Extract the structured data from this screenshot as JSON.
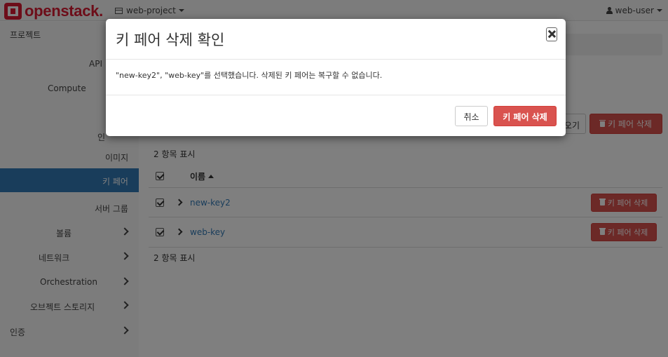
{
  "navbar": {
    "logo_text": "openstack.",
    "project": "web-project",
    "user": "web-user"
  },
  "sidebar": {
    "items": [
      {
        "label": "프로젝트"
      },
      {
        "label": "API"
      },
      {
        "label": "Compute"
      },
      {
        "label": "인"
      },
      {
        "label": "이미지"
      },
      {
        "label": "키 페어",
        "active": true
      },
      {
        "label": "서버 그룹"
      },
      {
        "label": "볼륨"
      },
      {
        "label": "네트워크"
      },
      {
        "label": "Orchestration"
      },
      {
        "label": "오브젝트 스토리지"
      },
      {
        "label": "인증"
      }
    ]
  },
  "main": {
    "import_button_partial": "오기",
    "delete_button": "키 페어 삭제",
    "count_text": "2 항목 표시",
    "table": {
      "header_name": "이름",
      "rows": [
        {
          "name": "new-key2",
          "action": "키 페어 삭제"
        },
        {
          "name": "web-key",
          "action": "키 페어 삭제"
        }
      ]
    }
  },
  "modal": {
    "title": "키 페어 삭제 확인",
    "message": "\"new-key2\", \"web-key\"를 선택했습니다. 삭제된 키 페어는 복구할 수 없습니다.",
    "cancel_label": "취소",
    "confirm_label": "키 페어 삭제"
  },
  "colors": {
    "brand": "#da1a32",
    "active": "#337ab7",
    "danger": "#d9534f"
  }
}
